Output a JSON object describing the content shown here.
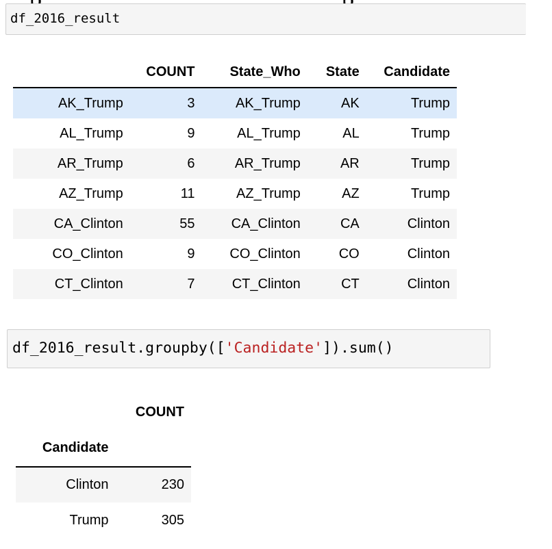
{
  "cells": [
    {
      "code": "df_2016_result",
      "output": {
        "columns": [
          "",
          "COUNT",
          "State_Who",
          "State",
          "Candidate"
        ],
        "rows": [
          {
            "index": "AK_Trump",
            "COUNT": "3",
            "State_Who": "AK_Trump",
            "State": "AK",
            "Candidate": "Trump"
          },
          {
            "index": "AL_Trump",
            "COUNT": "9",
            "State_Who": "AL_Trump",
            "State": "AL",
            "Candidate": "Trump"
          },
          {
            "index": "AR_Trump",
            "COUNT": "6",
            "State_Who": "AR_Trump",
            "State": "AR",
            "Candidate": "Trump"
          },
          {
            "index": "AZ_Trump",
            "COUNT": "11",
            "State_Who": "AZ_Trump",
            "State": "AZ",
            "Candidate": "Trump"
          },
          {
            "index": "CA_Clinton",
            "COUNT": "55",
            "State_Who": "CA_Clinton",
            "State": "CA",
            "Candidate": "Clinton"
          },
          {
            "index": "CO_Clinton",
            "COUNT": "9",
            "State_Who": "CO_Clinton",
            "State": "CO",
            "Candidate": "Clinton"
          },
          {
            "index": "CT_Clinton",
            "COUNT": "7",
            "State_Who": "CT_Clinton",
            "State": "CT",
            "Candidate": "Clinton"
          }
        ],
        "hovered_row": "AK_Trump"
      }
    },
    {
      "code_prefix": "df_2016_result.groupby([",
      "code_string": "'Candidate'",
      "code_suffix": "]).sum()",
      "output": {
        "value_column": "COUNT",
        "index_name": "Candidate",
        "rows": [
          {
            "index": "Clinton",
            "COUNT": "230"
          },
          {
            "index": "Trump",
            "COUNT": "305"
          }
        ]
      }
    }
  ],
  "colors": {
    "code_background": "#f5f5f5",
    "code_border": "#cfcfcf",
    "string_literal": "#ba2121",
    "row_stripe": "#f5f5f5",
    "row_hover": "#dbeafb"
  }
}
